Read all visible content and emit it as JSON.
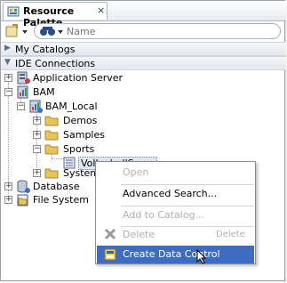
{
  "tab": {
    "title": "Resource Palette",
    "close": "×"
  },
  "search": {
    "placeholder": "Name"
  },
  "sections": {
    "catalogs": "My Catalogs",
    "connections": "IDE Connections"
  },
  "tree": {
    "app_server": "Application Server",
    "bam": "BAM",
    "bam_local": "BAM_Local",
    "demos": "Demos",
    "samples": "Samples",
    "sports": "Sports",
    "volleyball": "VolleyballScore",
    "system": "System",
    "database": "Database",
    "file_system": "File System"
  },
  "menu": {
    "open": "Open",
    "advanced_search": "Advanced Search...",
    "add_to_catalog": "Add to Catalog...",
    "delete": "Delete",
    "delete_shortcut": "Delete",
    "create_data_control": "Create Data Control"
  },
  "colors": {
    "selection": "#3d6cc0",
    "disabled": "#b0b0b0",
    "folder": "#e8c35a"
  }
}
